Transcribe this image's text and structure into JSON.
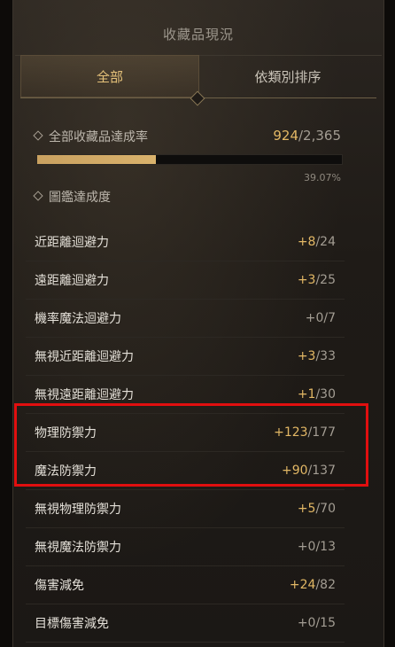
{
  "window": {
    "title": "收藏品現況"
  },
  "tabs": [
    {
      "label": "全部",
      "active": true
    },
    {
      "label": "依類別排序",
      "active": false
    }
  ],
  "overall": {
    "label": "全部收藏品達成率",
    "current": "924",
    "total": "/2,365",
    "percent_text": "39.07%",
    "progress": 0.3907
  },
  "codex": {
    "label": "圖鑑達成度"
  },
  "stats": [
    {
      "name": "近距離迴避力",
      "value": "+8",
      "max": "/24"
    },
    {
      "name": "遠距離迴避力",
      "value": "+3",
      "max": "/25"
    },
    {
      "name": "機率魔法迴避力",
      "value": "+0",
      "max": "/7"
    },
    {
      "name": "無視近距離迴避力",
      "value": "+3",
      "max": "/33"
    },
    {
      "name": "無視遠距離迴避力",
      "value": "+1",
      "max": "/30"
    },
    {
      "name": "物理防禦力",
      "value": "+123",
      "max": "/177"
    },
    {
      "name": "魔法防禦力",
      "value": "+90",
      "max": "/137"
    },
    {
      "name": "無視物理防禦力",
      "value": "+5",
      "max": "/70"
    },
    {
      "name": "無視魔法防禦力",
      "value": "+0",
      "max": "/13"
    },
    {
      "name": "傷害減免",
      "value": "+24",
      "max": "/82"
    },
    {
      "name": "目標傷害減免",
      "value": "+0",
      "max": "/15"
    }
  ],
  "colors": {
    "accent_gold": "#e3b865",
    "highlight_box": "#e10f0f",
    "background": "#1f1b17"
  }
}
